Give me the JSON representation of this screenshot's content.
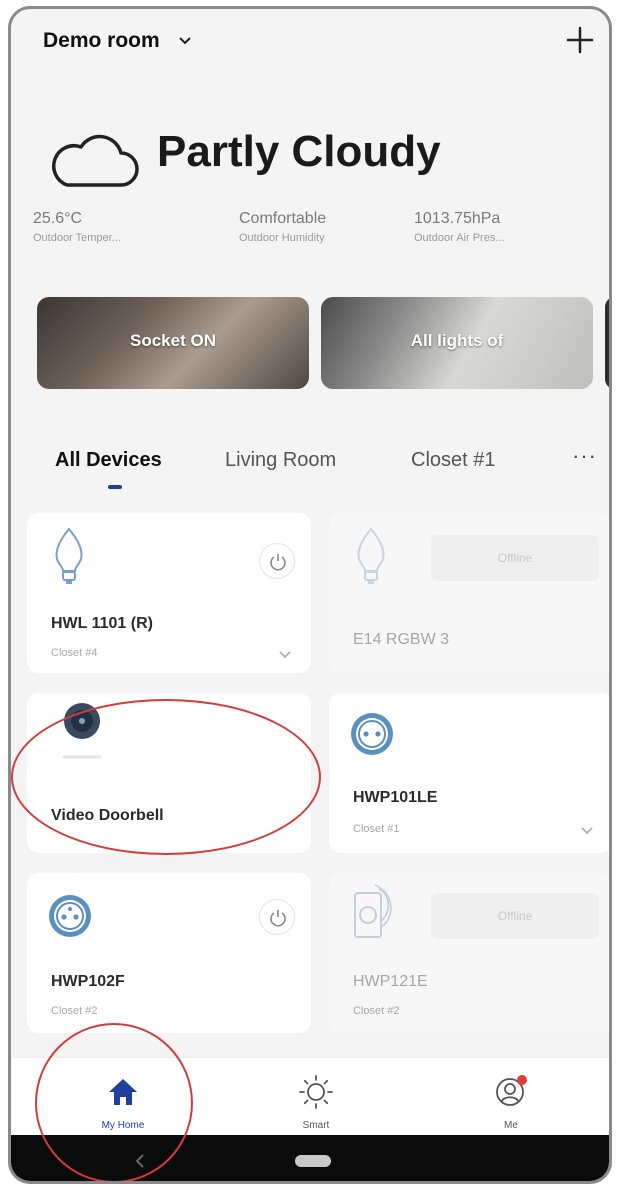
{
  "header": {
    "room": "Demo room"
  },
  "weather": {
    "condition": "Partly Cloudy",
    "stats": [
      {
        "value": "25.6°C",
        "label": "Outdoor Temper..."
      },
      {
        "value": "Comfortable",
        "label": "Outdoor Humidity"
      },
      {
        "value": "1013.75hPa",
        "label": "Outdoor Air Pres..."
      }
    ]
  },
  "scenes": [
    {
      "label": "Socket ON"
    },
    {
      "label": "All lights of"
    }
  ],
  "tabs": [
    {
      "label": "All Devices"
    },
    {
      "label": "Living Room"
    },
    {
      "label": "Closet #1"
    }
  ],
  "devices": [
    {
      "name": "HWL 1101 (R)",
      "room": "Closet #4"
    },
    {
      "name": "E14 RGBW 3",
      "status": "Offline"
    },
    {
      "name": "Video Doorbell"
    },
    {
      "name": "HWP101LE",
      "room": "Closet #1"
    },
    {
      "name": "HWP102F",
      "room": "Closet #2"
    },
    {
      "name": "HWP121E",
      "room": "Closet #2",
      "status": "Offline"
    }
  ],
  "nav": [
    {
      "label": "My Home"
    },
    {
      "label": "Smart"
    },
    {
      "label": "Me"
    }
  ],
  "colors": {
    "accent": "#1f3f9c",
    "socket_blue": "#5b8fbe",
    "notification": "#e53935",
    "annotation": "#d23c3c"
  }
}
